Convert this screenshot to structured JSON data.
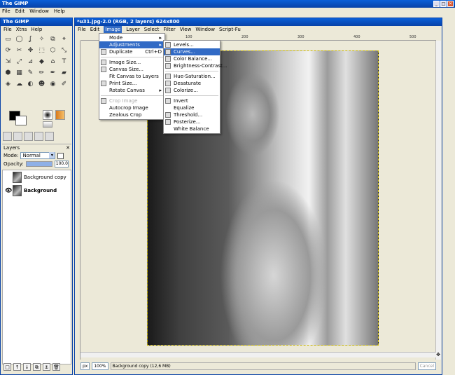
{
  "app": {
    "title": "The GIMP",
    "menu": [
      "File",
      "Edit",
      "Window",
      "Help"
    ],
    "window_buttons": [
      "_",
      "□",
      "✕"
    ]
  },
  "toolbox": {
    "title": "The GIMP",
    "menu": [
      "File",
      "Xtns",
      "Help"
    ],
    "tools": [
      "▭",
      "◯",
      "ʆ",
      "✧",
      "⧉",
      "⌖",
      "⟳",
      "✂",
      "✥",
      "⬚",
      "⬡",
      "⤡",
      "⇲",
      "⤢",
      "⊿",
      "◆",
      "⌂",
      "T",
      "⬢",
      "▦",
      "✎",
      "✏",
      "✒",
      "▰",
      "◈",
      "☁",
      "◐",
      "☻",
      "◉",
      "✐"
    ]
  },
  "layers": {
    "title": "Layers",
    "mode_label": "Mode:",
    "mode_value": "Normal",
    "opacity_label": "Opacity:",
    "opacity_value": "100.0",
    "opacity_fraction": 1.0,
    "items": [
      {
        "name": "Background copy",
        "visible": false,
        "selected": false
      },
      {
        "name": "Background",
        "visible": true,
        "selected": true
      }
    ],
    "buttons": [
      "□",
      "↑",
      "↓",
      "⧉",
      "⚓",
      "🗑"
    ]
  },
  "image_window": {
    "title": "*u31.jpg-2.0 (RGB, 2 layers) 624x800",
    "menu": [
      "File",
      "Edit",
      "Image",
      "Layer",
      "Select",
      "Filter",
      "View",
      "Window",
      "Script-Fu"
    ],
    "open_menu": "Image",
    "ruler_marks": [
      "100",
      "200",
      "300",
      "400",
      "500"
    ],
    "unit": "px",
    "zoom": "100%",
    "status": "Background copy (12,6 MB)",
    "cancel": "Cancel"
  },
  "image_menu": {
    "items": [
      {
        "label": "Mode",
        "submenu": true
      },
      {
        "label": "Adjustments",
        "submenu": true,
        "highlighted": true
      },
      {
        "label": "Duplicate",
        "shortcut": "Ctrl+D",
        "icon": true
      },
      {
        "sep": true
      },
      {
        "label": "Image Size...",
        "icon": true
      },
      {
        "label": "Canvas Size...",
        "icon": true
      },
      {
        "label": "Fit Canvas to Layers"
      },
      {
        "label": "Print Size...",
        "icon": true
      },
      {
        "label": "Rotate Canvas",
        "submenu": true
      },
      {
        "sep": true
      },
      {
        "label": "Crop Image",
        "disabled": true,
        "icon": true
      },
      {
        "label": "Autocrop Image"
      },
      {
        "label": "Zealous Crop"
      }
    ]
  },
  "adjustments_menu": {
    "items": [
      {
        "label": "Levels...",
        "icon": true
      },
      {
        "label": "Curves...",
        "icon": true,
        "highlighted": true
      },
      {
        "label": "Color Balance...",
        "icon": true
      },
      {
        "label": "Brightness-Contrast...",
        "icon": true
      },
      {
        "sep": true
      },
      {
        "label": "Hue-Saturation...",
        "icon": true
      },
      {
        "label": "Desaturate",
        "icon": true
      },
      {
        "label": "Colorize...",
        "icon": true
      },
      {
        "sep": true
      },
      {
        "label": "Invert",
        "icon": true
      },
      {
        "label": "Equalize"
      },
      {
        "label": "Threshold...",
        "icon": true
      },
      {
        "label": "Posterize...",
        "icon": true
      },
      {
        "label": "White Balance"
      }
    ]
  }
}
